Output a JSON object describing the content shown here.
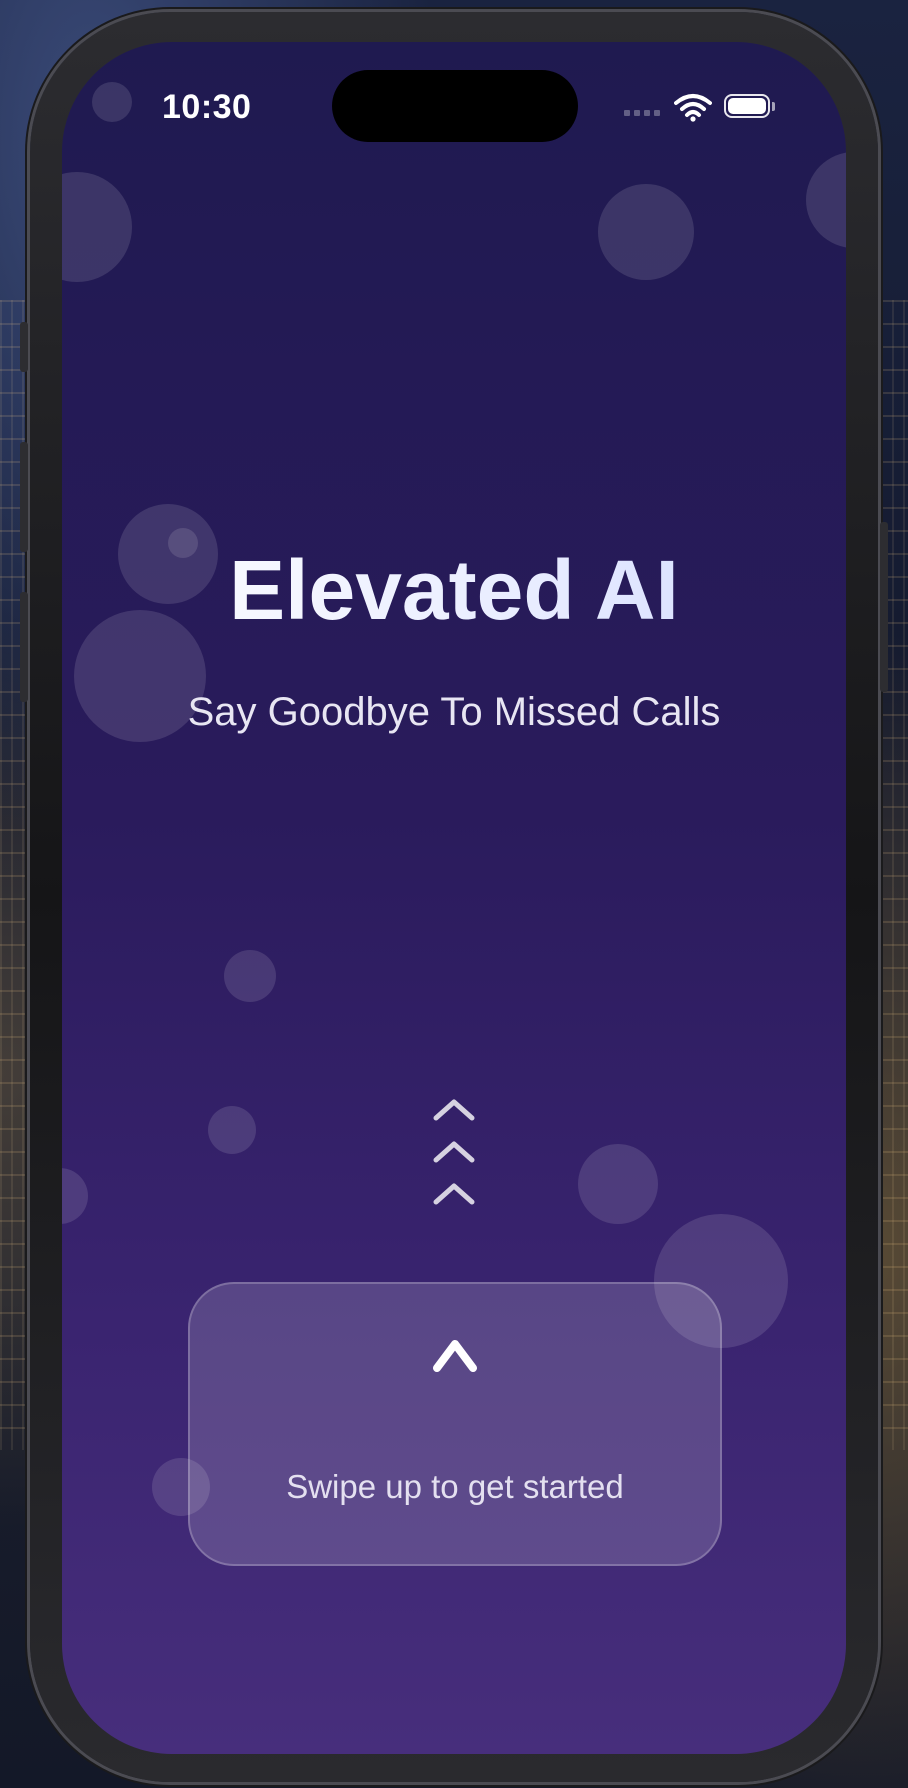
{
  "status_bar": {
    "time": "10:30",
    "signal_icon": "signal-dots-icon",
    "wifi_icon": "wifi-icon",
    "battery_icon": "battery-icon"
  },
  "hero": {
    "title": "Elevated AI",
    "subtitle": "Say Goodbye To Missed Calls"
  },
  "swipe": {
    "indicator_icon": "triple-chevron-up-icon",
    "card_icon": "caret-up-icon",
    "label": "Swipe up to get started"
  },
  "colors": {
    "screen_top": "#1f1a50",
    "screen_bottom": "#472e7c",
    "text": "#ffffff"
  }
}
